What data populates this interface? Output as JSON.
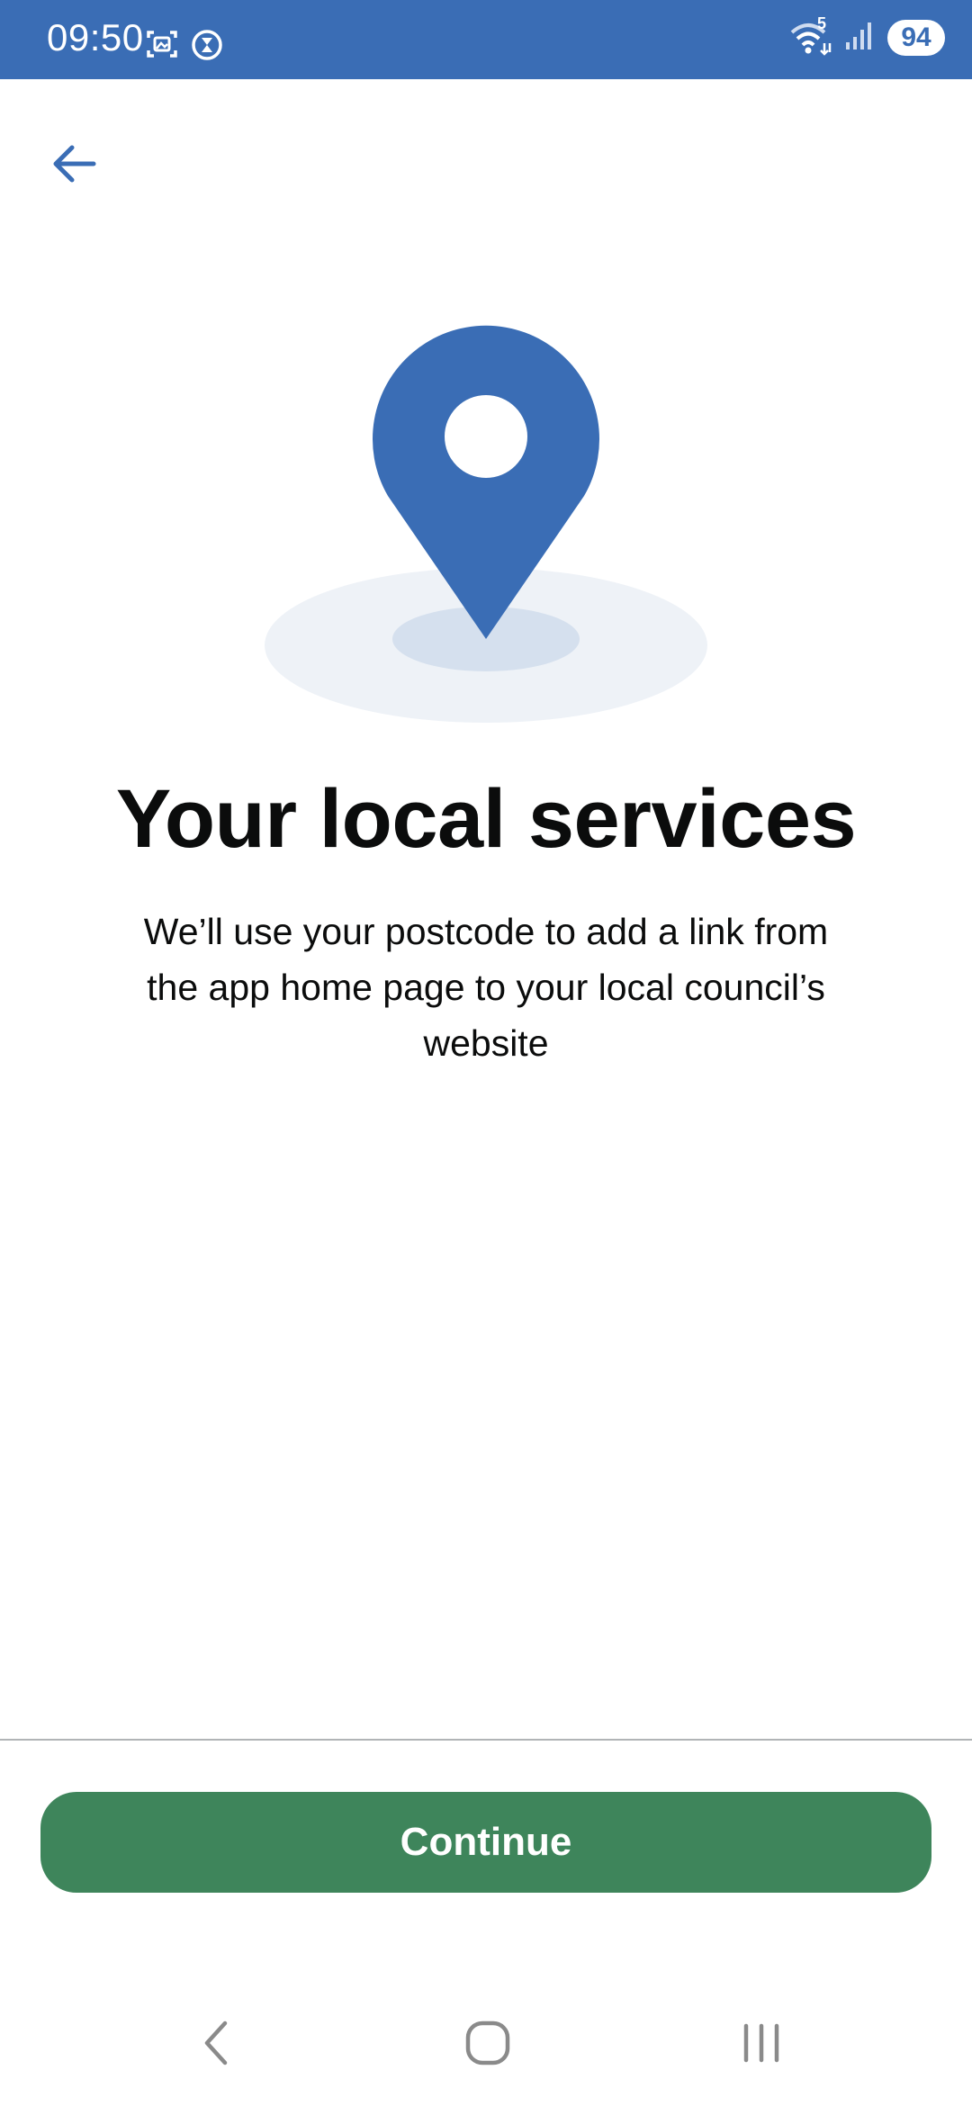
{
  "status_bar": {
    "time": "09:50",
    "battery": "94",
    "network_badge": "5",
    "icons": [
      "screenshot-icon",
      "timer-icon",
      "wifi-icon",
      "signal-icon",
      "battery-icon"
    ],
    "background_color": "#3A6DB5"
  },
  "header": {
    "back_icon": "back-arrow-icon",
    "back_color": "#3A6DB5"
  },
  "illustration": {
    "icon": "location-pin-icon",
    "pin_color": "#3A6DB5",
    "ground_color": "#EEF2F7",
    "shadow_color": "#D5E0EE"
  },
  "main": {
    "title": "Your local services",
    "body": "We’ll use your postcode to add a link from the app home page to your local council’s website"
  },
  "footer": {
    "continue_label": "Continue",
    "continue_color": "#3E855B"
  },
  "nav_bar": {
    "icons": [
      "nav-back-icon",
      "nav-home-icon",
      "nav-recents-icon"
    ]
  }
}
